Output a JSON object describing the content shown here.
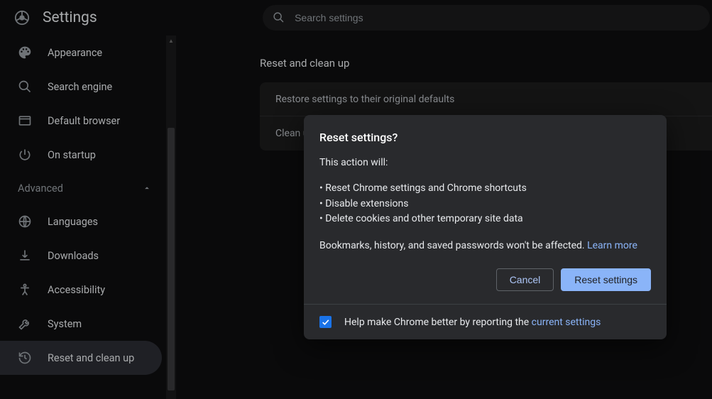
{
  "header": {
    "title": "Settings",
    "search_placeholder": "Search settings"
  },
  "sidebar": {
    "items": [
      {
        "icon": "palette",
        "label": "Appearance"
      },
      {
        "icon": "search",
        "label": "Search engine"
      },
      {
        "icon": "browser",
        "label": "Default browser"
      },
      {
        "icon": "power",
        "label": "On startup"
      }
    ],
    "advanced_label": "Advanced",
    "advanced_items": [
      {
        "icon": "globe",
        "label": "Languages"
      },
      {
        "icon": "download",
        "label": "Downloads"
      },
      {
        "icon": "accessibility",
        "label": "Accessibility"
      },
      {
        "icon": "wrench",
        "label": "System"
      },
      {
        "icon": "history",
        "label": "Reset and clean up",
        "active": true
      }
    ]
  },
  "main": {
    "section_title": "Reset and clean up",
    "rows": [
      "Restore settings to their original defaults",
      "Clean up computer"
    ]
  },
  "dialog": {
    "title": "Reset settings?",
    "intro": "This action will:",
    "bullets": [
      "Reset Chrome settings and Chrome shortcuts",
      "Disable extensions",
      "Delete cookies and other temporary site data"
    ],
    "note_prefix": "Bookmarks, history, and saved passwords won't be affected. ",
    "learn_more": "Learn more",
    "cancel": "Cancel",
    "confirm": "Reset settings",
    "report_prefix": "Help make Chrome better by reporting the ",
    "report_link": "current settings",
    "report_checked": true
  }
}
